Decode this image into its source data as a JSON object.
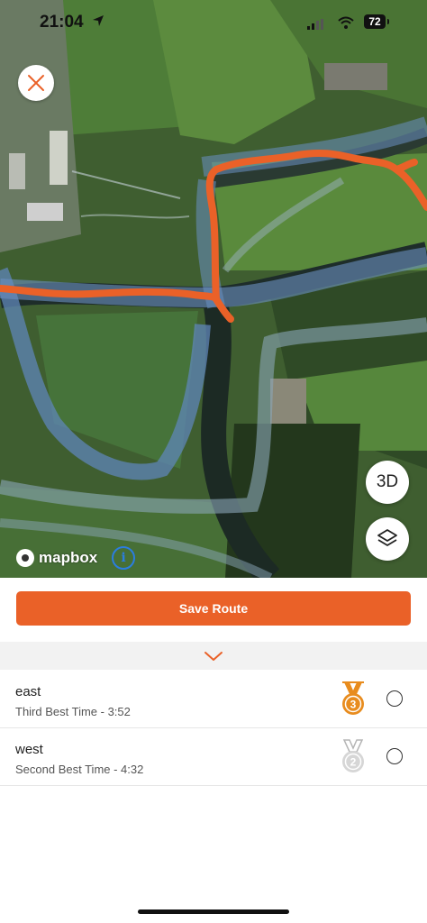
{
  "status_bar": {
    "time": "21:04",
    "battery": "72"
  },
  "map": {
    "attribution_brand": "mapbox",
    "info_label": "i",
    "btn_3d_label": "3D",
    "route_color": "#ea6128"
  },
  "actions": {
    "save_label": "Save Route"
  },
  "routes": [
    {
      "name": "east",
      "subtitle": "Third Best Time - 3:52",
      "medal": "bronze",
      "medal_number": "3",
      "selected": false
    },
    {
      "name": "west",
      "subtitle": "Second Best Time - 4:32",
      "medal": "silver",
      "medal_number": "2",
      "selected": false
    }
  ],
  "colors": {
    "accent": "#ea6128",
    "bronze": "#e88c1e",
    "silver": "#b5b5b5"
  }
}
